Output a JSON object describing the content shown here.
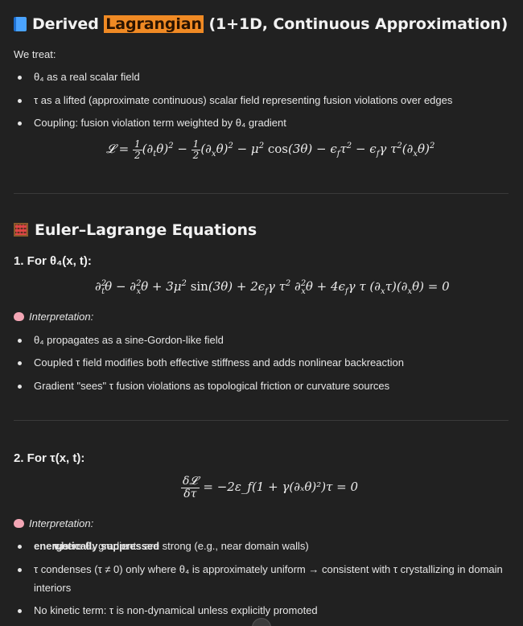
{
  "section1": {
    "title_pre": "Derived ",
    "title_highlight": "Lagrangian",
    "title_post": " (1+1D, Continuous Approximation)",
    "icon": "blue-book-icon",
    "intro": "We treat:",
    "bullets": [
      "θ₄ as a real scalar field",
      "τ as a lifted (approximate continuous) scalar field representing fusion violations over edges",
      "Coupling: fusion violation term weighted by θ₄ gradient"
    ],
    "equation": "𝓛 = ½(∂ₜθ)² − ½(∂ₓθ)² − μ² cos(3θ) − ε_f τ² − ε_f γ τ²(∂ₓθ)²"
  },
  "section2": {
    "title": "Euler–Lagrange Equations",
    "icon": "abacus-icon",
    "part1": {
      "heading": "1. For θ₄(x, t):",
      "equation": "∂ₜ²θ − ∂ₓ²θ + 3μ² sin(3θ) + 2ε_f γ τ² ∂ₓ²θ + 4ε_f γ τ (∂ₓτ)(∂ₓθ) = 0",
      "interpretation_label": "Interpretation:",
      "bullets": [
        "θ₄ propagates as a sine-Gordon-like field",
        "Coupled τ field modifies both effective stiffness and adds nonlinear backreaction",
        "Gradient \"sees\" τ fusion violations as topological friction or curvature sources"
      ]
    },
    "part2": {
      "heading": "2. For τ(x, t):",
      "equation_rhs": "= −2ε_f(1 + γ(∂ₓθ)²)τ = 0",
      "interpretation_label": "Interpretation:",
      "bullets": [
        {
          "pre": "τ is ",
          "bold": "energetically suppressed",
          "post": " where θ₄ gradients are strong (e.g., near domain walls)"
        },
        {
          "pre": "τ condenses (τ ≠ 0) only where θ₄ is approximately uniform → consistent with τ crystallizing in domain",
          "line2": "interiors"
        },
        {
          "pre": "No kinetic term: τ is non-dynamical unless explicitly promoted"
        }
      ]
    }
  }
}
